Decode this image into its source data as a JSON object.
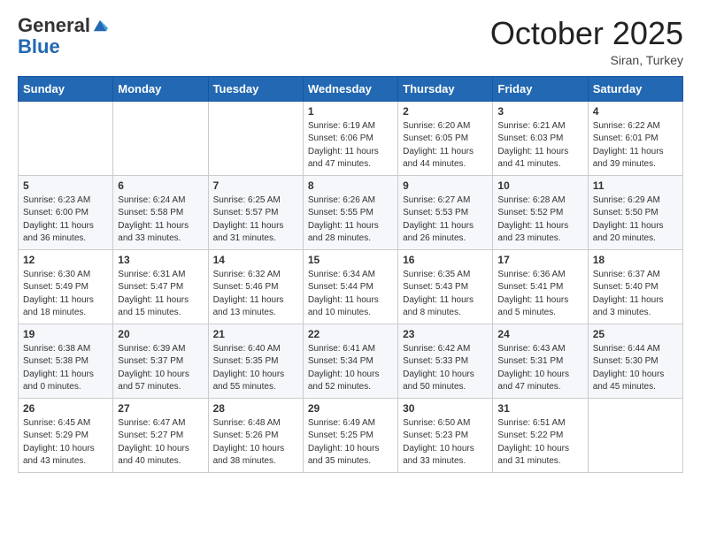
{
  "header": {
    "logo_general": "General",
    "logo_blue": "Blue",
    "month_title": "October 2025",
    "location": "Siran, Turkey"
  },
  "days_of_week": [
    "Sunday",
    "Monday",
    "Tuesday",
    "Wednesday",
    "Thursday",
    "Friday",
    "Saturday"
  ],
  "weeks": [
    [
      {
        "day": "",
        "info": ""
      },
      {
        "day": "",
        "info": ""
      },
      {
        "day": "",
        "info": ""
      },
      {
        "day": "1",
        "info": "Sunrise: 6:19 AM\nSunset: 6:06 PM\nDaylight: 11 hours\nand 47 minutes."
      },
      {
        "day": "2",
        "info": "Sunrise: 6:20 AM\nSunset: 6:05 PM\nDaylight: 11 hours\nand 44 minutes."
      },
      {
        "day": "3",
        "info": "Sunrise: 6:21 AM\nSunset: 6:03 PM\nDaylight: 11 hours\nand 41 minutes."
      },
      {
        "day": "4",
        "info": "Sunrise: 6:22 AM\nSunset: 6:01 PM\nDaylight: 11 hours\nand 39 minutes."
      }
    ],
    [
      {
        "day": "5",
        "info": "Sunrise: 6:23 AM\nSunset: 6:00 PM\nDaylight: 11 hours\nand 36 minutes."
      },
      {
        "day": "6",
        "info": "Sunrise: 6:24 AM\nSunset: 5:58 PM\nDaylight: 11 hours\nand 33 minutes."
      },
      {
        "day": "7",
        "info": "Sunrise: 6:25 AM\nSunset: 5:57 PM\nDaylight: 11 hours\nand 31 minutes."
      },
      {
        "day": "8",
        "info": "Sunrise: 6:26 AM\nSunset: 5:55 PM\nDaylight: 11 hours\nand 28 minutes."
      },
      {
        "day": "9",
        "info": "Sunrise: 6:27 AM\nSunset: 5:53 PM\nDaylight: 11 hours\nand 26 minutes."
      },
      {
        "day": "10",
        "info": "Sunrise: 6:28 AM\nSunset: 5:52 PM\nDaylight: 11 hours\nand 23 minutes."
      },
      {
        "day": "11",
        "info": "Sunrise: 6:29 AM\nSunset: 5:50 PM\nDaylight: 11 hours\nand 20 minutes."
      }
    ],
    [
      {
        "day": "12",
        "info": "Sunrise: 6:30 AM\nSunset: 5:49 PM\nDaylight: 11 hours\nand 18 minutes."
      },
      {
        "day": "13",
        "info": "Sunrise: 6:31 AM\nSunset: 5:47 PM\nDaylight: 11 hours\nand 15 minutes."
      },
      {
        "day": "14",
        "info": "Sunrise: 6:32 AM\nSunset: 5:46 PM\nDaylight: 11 hours\nand 13 minutes."
      },
      {
        "day": "15",
        "info": "Sunrise: 6:34 AM\nSunset: 5:44 PM\nDaylight: 11 hours\nand 10 minutes."
      },
      {
        "day": "16",
        "info": "Sunrise: 6:35 AM\nSunset: 5:43 PM\nDaylight: 11 hours\nand 8 minutes."
      },
      {
        "day": "17",
        "info": "Sunrise: 6:36 AM\nSunset: 5:41 PM\nDaylight: 11 hours\nand 5 minutes."
      },
      {
        "day": "18",
        "info": "Sunrise: 6:37 AM\nSunset: 5:40 PM\nDaylight: 11 hours\nand 3 minutes."
      }
    ],
    [
      {
        "day": "19",
        "info": "Sunrise: 6:38 AM\nSunset: 5:38 PM\nDaylight: 11 hours\nand 0 minutes."
      },
      {
        "day": "20",
        "info": "Sunrise: 6:39 AM\nSunset: 5:37 PM\nDaylight: 10 hours\nand 57 minutes."
      },
      {
        "day": "21",
        "info": "Sunrise: 6:40 AM\nSunset: 5:35 PM\nDaylight: 10 hours\nand 55 minutes."
      },
      {
        "day": "22",
        "info": "Sunrise: 6:41 AM\nSunset: 5:34 PM\nDaylight: 10 hours\nand 52 minutes."
      },
      {
        "day": "23",
        "info": "Sunrise: 6:42 AM\nSunset: 5:33 PM\nDaylight: 10 hours\nand 50 minutes."
      },
      {
        "day": "24",
        "info": "Sunrise: 6:43 AM\nSunset: 5:31 PM\nDaylight: 10 hours\nand 47 minutes."
      },
      {
        "day": "25",
        "info": "Sunrise: 6:44 AM\nSunset: 5:30 PM\nDaylight: 10 hours\nand 45 minutes."
      }
    ],
    [
      {
        "day": "26",
        "info": "Sunrise: 6:45 AM\nSunset: 5:29 PM\nDaylight: 10 hours\nand 43 minutes."
      },
      {
        "day": "27",
        "info": "Sunrise: 6:47 AM\nSunset: 5:27 PM\nDaylight: 10 hours\nand 40 minutes."
      },
      {
        "day": "28",
        "info": "Sunrise: 6:48 AM\nSunset: 5:26 PM\nDaylight: 10 hours\nand 38 minutes."
      },
      {
        "day": "29",
        "info": "Sunrise: 6:49 AM\nSunset: 5:25 PM\nDaylight: 10 hours\nand 35 minutes."
      },
      {
        "day": "30",
        "info": "Sunrise: 6:50 AM\nSunset: 5:23 PM\nDaylight: 10 hours\nand 33 minutes."
      },
      {
        "day": "31",
        "info": "Sunrise: 6:51 AM\nSunset: 5:22 PM\nDaylight: 10 hours\nand 31 minutes."
      },
      {
        "day": "",
        "info": ""
      }
    ]
  ]
}
